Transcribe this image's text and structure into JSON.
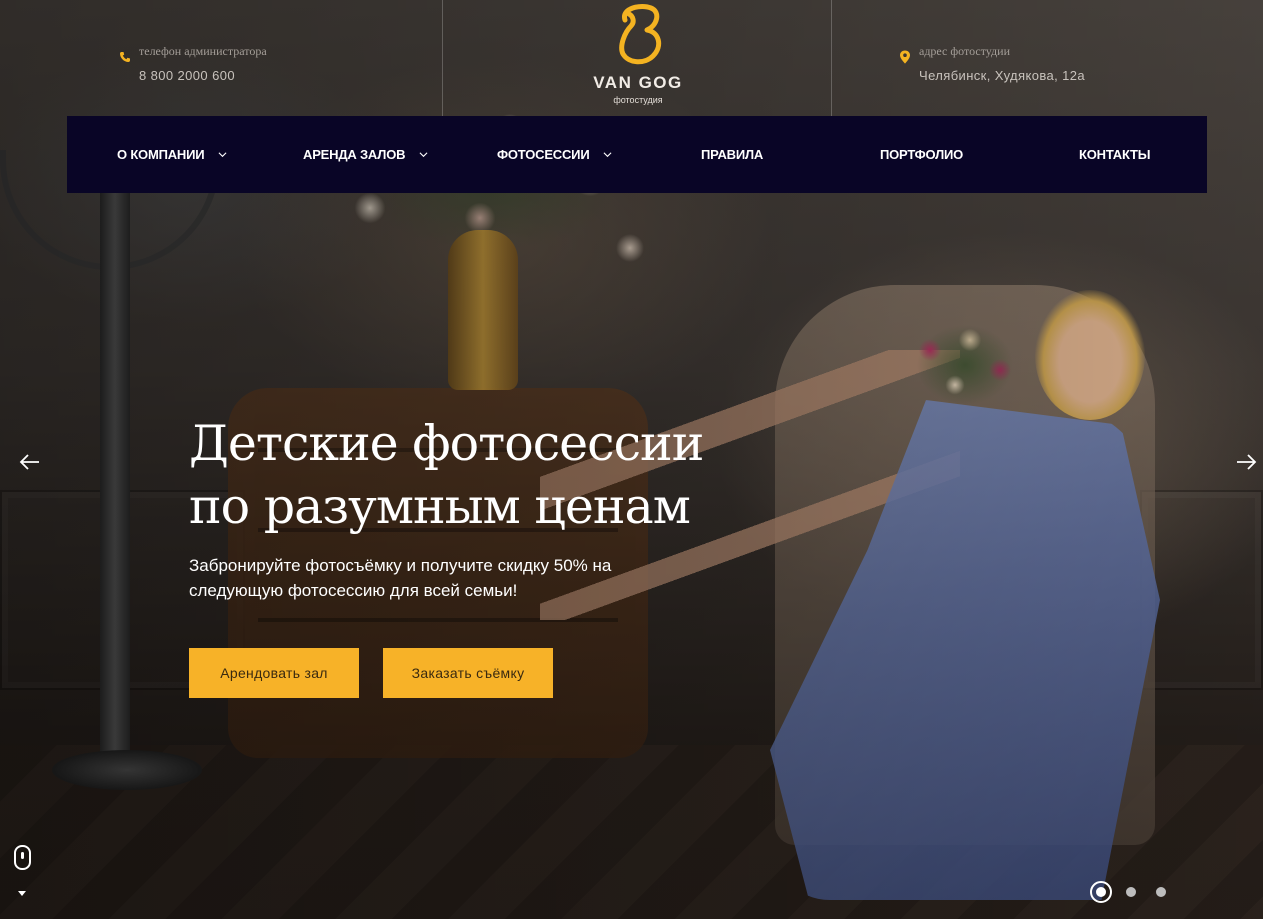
{
  "header": {
    "phone": {
      "label": "телефон администратора",
      "value": "8 800 2000 600"
    },
    "address": {
      "label": "адрес фотостудии",
      "value": "Челябинск, Худякова, 12а"
    },
    "logo": {
      "name": "VAN GOG",
      "subtitle": "фотостудия"
    }
  },
  "nav": {
    "items": [
      {
        "label": "О компании",
        "has_dropdown": true
      },
      {
        "label": "Аренда залов",
        "has_dropdown": true
      },
      {
        "label": "Фотосессии",
        "has_dropdown": true
      },
      {
        "label": "Правила",
        "has_dropdown": false
      },
      {
        "label": "Портфолио",
        "has_dropdown": false
      },
      {
        "label": "Контакты",
        "has_dropdown": false
      }
    ]
  },
  "hero": {
    "title_line1": "Детские фотосессии",
    "title_line2": "по разумным ценам",
    "subtitle": "Забронируйте фотосъёмку и получите скидку 50% на следующую фотосессию для всей семьи!",
    "button_rent": "Арендовать зал",
    "button_order": "Заказать съёмку"
  },
  "slider": {
    "slide_count": 3,
    "active_slide": 1
  },
  "icons": {
    "phone": "phone-icon",
    "address": "map-pin-icon",
    "logo": "logo-b-icon",
    "dropdown": "chevron-down-icon",
    "prev": "arrow-left-icon",
    "next": "arrow-right-icon",
    "scroll": "mouse-scroll-icon"
  },
  "colors": {
    "accent": "#f7b228",
    "nav_bg": "#090526",
    "logo": "#f4b321"
  }
}
